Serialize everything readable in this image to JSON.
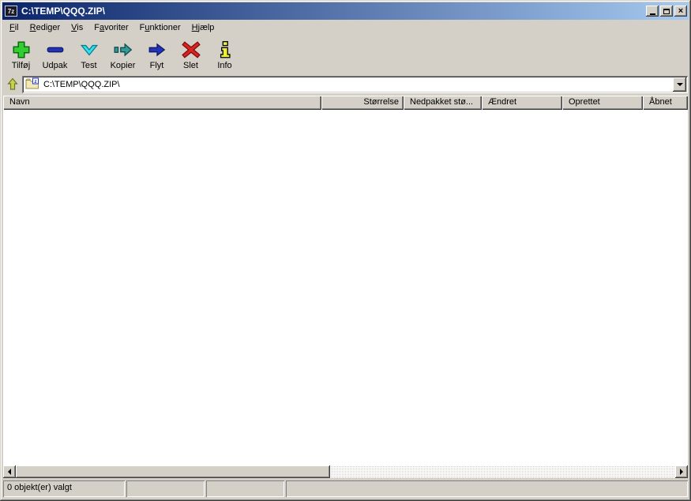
{
  "window": {
    "title": "C:\\TEMP\\QQQ.ZIP\\",
    "app_icon_text": "7z"
  },
  "titlebar": {
    "close_glyph": "×"
  },
  "menu": {
    "items": [
      {
        "pre": "",
        "key": "F",
        "post": "il"
      },
      {
        "pre": "",
        "key": "R",
        "post": "ediger"
      },
      {
        "pre": "",
        "key": "V",
        "post": "is"
      },
      {
        "pre": "F",
        "key": "a",
        "post": "voriter"
      },
      {
        "pre": "F",
        "key": "u",
        "post": "nktioner"
      },
      {
        "pre": "",
        "key": "H",
        "post": "jælp"
      }
    ]
  },
  "toolbar": {
    "buttons": [
      {
        "label": "Tilføj",
        "icon": "add-plus-icon"
      },
      {
        "label": "Udpak",
        "icon": "extract-minus-icon"
      },
      {
        "label": "Test",
        "icon": "test-check-icon"
      },
      {
        "label": "Kopier",
        "icon": "copy-arrow-icon"
      },
      {
        "label": "Flyt",
        "icon": "move-arrow-icon"
      },
      {
        "label": "Slet",
        "icon": "delete-x-icon"
      },
      {
        "label": "Info",
        "icon": "info-icon"
      }
    ]
  },
  "addressbar": {
    "path": "C:\\TEMP\\QQQ.ZIP\\",
    "zip_badge_letter": "z"
  },
  "columns": [
    {
      "label": "Navn"
    },
    {
      "label": "Størrelse"
    },
    {
      "label": "Nedpakket stø..."
    },
    {
      "label": "Ændret"
    },
    {
      "label": "Oprettet"
    },
    {
      "label": "Åbnet"
    }
  ],
  "list": {
    "rows": []
  },
  "statusbar": {
    "selection": "0 objekt(er) valgt",
    "panel2": "",
    "panel3": "",
    "panel4": ""
  },
  "colors": {
    "titlebar_gradient_start": "#0a246a",
    "titlebar_gradient_end": "#a6caf0",
    "chrome": "#d4d0c8",
    "add_green": "#33cc33",
    "extract_blue": "#2233bb",
    "test_cyan": "#33e0ee",
    "copy_teal": "#339999",
    "delete_red": "#dd2222",
    "info_yellow": "#eeee33"
  }
}
